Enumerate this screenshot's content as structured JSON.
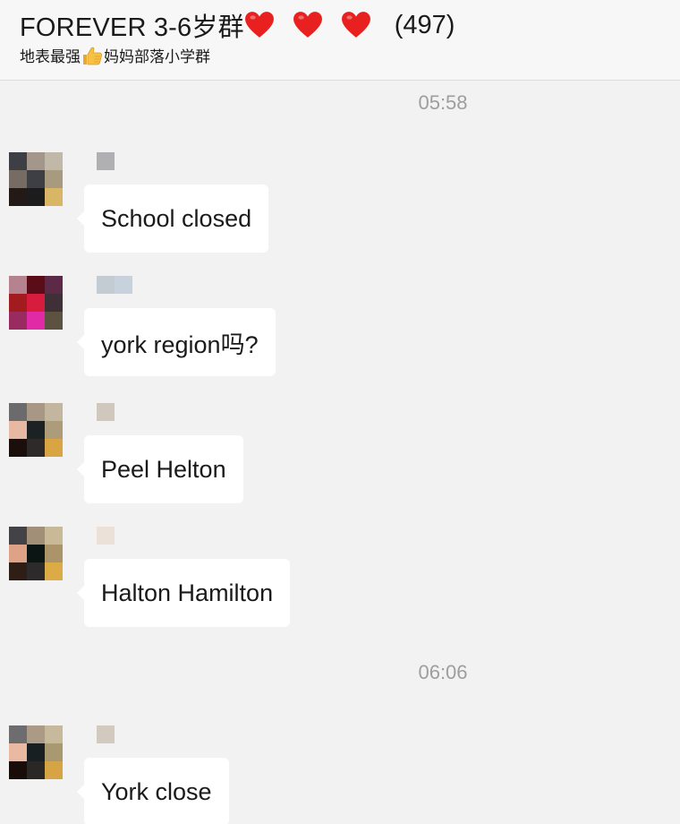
{
  "header": {
    "title": "FOREVER 3-6岁群",
    "member_count": "(497)",
    "subtitle_before": "地表最强",
    "subtitle_after": "妈妈部落小学群",
    "heart_color": "#e8201f",
    "title_icons": [
      "heart-icon",
      "heart-icon",
      "heart-icon"
    ],
    "subtitle_icon": "thumbs-up-icon"
  },
  "timestamps": [
    "05:58",
    "06:06"
  ],
  "messages": [
    {
      "text": "School closed",
      "avatar_colors": [
        "#3d3f45",
        "#a4968a",
        "#c0b8a8",
        "#776c63",
        "#3e3f45",
        "#a89a7e",
        "#231a17",
        "#1c1c1c",
        "#d9b566"
      ],
      "name_colors": [
        "#b0b0b3"
      ]
    },
    {
      "text": "york region吗?",
      "avatar_colors": [
        "#b5838f",
        "#5a0d16",
        "#5c2a46",
        "#a21b1e",
        "#d81c3d",
        "#3f2f36",
        "#9a2b60",
        "#e02aa6",
        "#5c5241"
      ],
      "name_colors": [
        "#c3cbd3",
        "#c8d2dc"
      ]
    },
    {
      "text": "Peel Helton",
      "avatar_colors": [
        "#6b6a6c",
        "#a79784",
        "#c2b69f",
        "#e7b9a3",
        "#1c2124",
        "#ad9c79",
        "#1c0f0b",
        "#2d2a29",
        "#d9a542"
      ],
      "name_colors": [
        "#d0c7bd"
      ]
    },
    {
      "text": "Halton Hamilton",
      "avatar_colors": [
        "#434246",
        "#a28f78",
        "#c8b997",
        "#dea386",
        "#0b1514",
        "#ab9469",
        "#2e1e16",
        "#2c2a2a",
        "#dbac46"
      ],
      "name_colors": [
        "#ece1d8"
      ]
    },
    {
      "text": "York close",
      "avatar_colors": [
        "#6d6c6e",
        "#ab9a86",
        "#c6b99c",
        "#eab9a2",
        "#181f22",
        "#a99971",
        "#1a0c08",
        "#2a2827",
        "#d7a445"
      ],
      "name_colors": [
        "#d2c9bf"
      ]
    }
  ]
}
